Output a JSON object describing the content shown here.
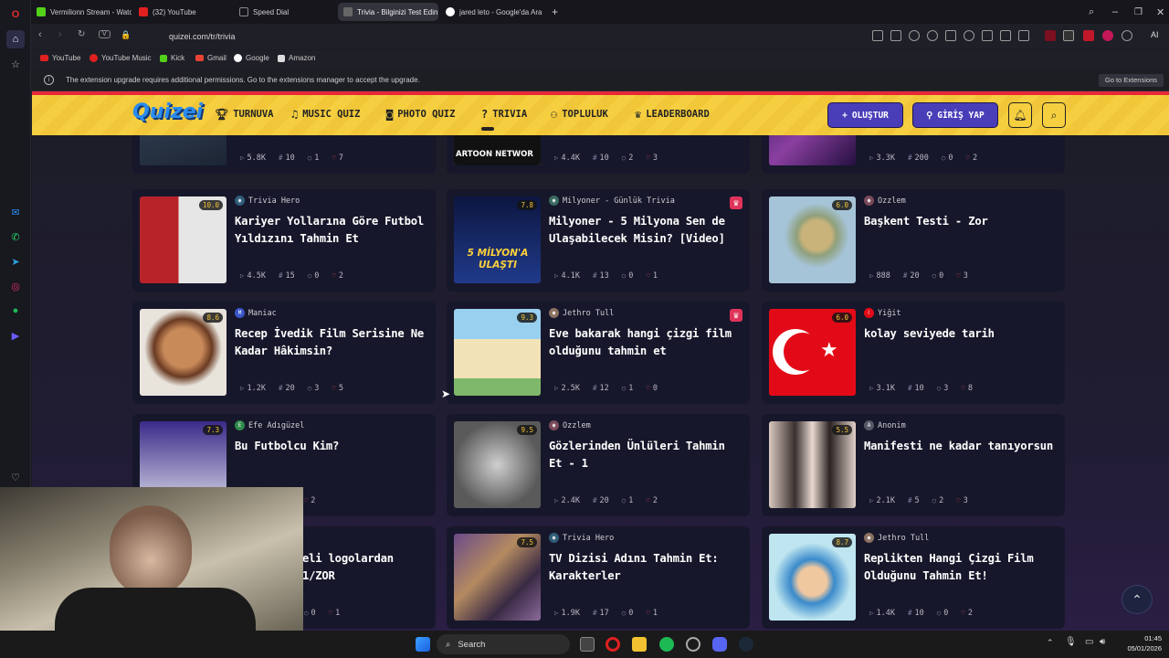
{
  "browser": {
    "tabs": [
      {
        "label": "Vermilionn Stream - Watc",
        "color": "#53d11a"
      },
      {
        "label": "(32) YouTube",
        "color": "#e02020"
      },
      {
        "label": "Speed Dial",
        "color": "#555"
      },
      {
        "label": "Trivia - Bilginizi Test Edin",
        "color": "#555"
      },
      {
        "label": "jared leto - Google'da Ara",
        "color": "#ffffff"
      }
    ],
    "url": "quizei.com/tr/trivia",
    "bookmarks": [
      "YouTube",
      "YouTube Music",
      "Kick",
      "Gmail",
      "Google",
      "Amazon"
    ],
    "notice": "The extension upgrade requires additional permissions. Go to the extensions manager to accept the upgrade.",
    "notice_button": "Go to Extensions",
    "ai_label": "AI"
  },
  "site": {
    "logo": "Quizei",
    "nav": [
      "TURNUVA",
      "MUSIC QUIZ",
      "PHOTO QUIZ",
      "TRIVIA",
      "TOPLULUK",
      "LEADERBOARD"
    ],
    "create": "OLUŞTUR",
    "login": "GİRİŞ YAP"
  },
  "top_row_stats": [
    [
      "5.8K",
      "10",
      "1",
      "7"
    ],
    [
      "4.4K",
      "10",
      "2",
      "3"
    ],
    [
      "3.3K",
      "200",
      "0",
      "2"
    ]
  ],
  "top_row_thumb_text": "ARTOON NETWOR",
  "cards": [
    {
      "rating": "10.0",
      "author": "Trivia Hero",
      "title": "Kariyer Yollarına Göre Futbol Yıldızını Tahmin Et",
      "plays": "4.5K",
      "questions": "15",
      "comments": "0",
      "likes": "2"
    },
    {
      "rating": "7.8",
      "author": "Milyoner - Günlük Trivia",
      "title": "Milyoner - 5 Milyona Sen de Ulaşabilecek Misin? [Video]",
      "plays": "4.1K",
      "questions": "13",
      "comments": "0",
      "likes": "1",
      "thumb_text": "5 MİLYON'A ULAŞTI"
    },
    {
      "rating": "6.0",
      "author": "Ozzlem",
      "title": "Başkent Testi - Zor",
      "plays": "888",
      "questions": "20",
      "comments": "0",
      "likes": "3"
    },
    {
      "rating": "8.6",
      "author": "Maniac",
      "title": "Recep İvedik Film Serisine Ne Kadar Hâkimsin?",
      "plays": "1.2K",
      "questions": "20",
      "comments": "3",
      "likes": "5"
    },
    {
      "rating": "9.3",
      "author": "Jethro Tull",
      "title": "Eve bakarak hangi çizgi film olduğunu tahmin et",
      "plays": "2.5K",
      "questions": "12",
      "comments": "1",
      "likes": "0"
    },
    {
      "rating": "6.0",
      "author": "Yiğit",
      "title": "kolay seviyede tarih",
      "plays": "3.1K",
      "questions": "10",
      "comments": "3",
      "likes": "8"
    },
    {
      "rating": "7.3",
      "author": "Efe Adıgüzel",
      "title": "Bu Futbolcu Kim?",
      "plays": "",
      "questions": "",
      "comments": "0",
      "likes": "2"
    },
    {
      "rating": "9.5",
      "author": "Ozzlem",
      "title": "Gözlerinden Ünlüleri Tahmin Et - 1",
      "plays": "2.4K",
      "questions": "20",
      "comments": "1",
      "likes": "2"
    },
    {
      "rating": "5.5",
      "author": "Anonim",
      "title": "Manifesti ne kadar tanıyorsun",
      "plays": "2.1K",
      "questions": "5",
      "comments": "2",
      "likes": "3"
    },
    {
      "rating": "",
      "author": "",
      "title": "eli logolardan 1/ZOR",
      "plays": "",
      "questions": "",
      "comments": "0",
      "likes": "1"
    },
    {
      "rating": "7.5",
      "author": "Trivia Hero",
      "title": "TV Dizisi Adını Tahmin Et: Karakterler",
      "plays": "1.9K",
      "questions": "17",
      "comments": "0",
      "likes": "1"
    },
    {
      "rating": "8.7",
      "author": "Jethro Tull",
      "title": "Replikten Hangi Çizgi Film Olduğunu Tahmin Et!",
      "plays": "1.4K",
      "questions": "10",
      "comments": "0",
      "likes": "2"
    }
  ],
  "taskbar": {
    "search": "Search",
    "time": "01:45",
    "date": "05/01/2026"
  }
}
